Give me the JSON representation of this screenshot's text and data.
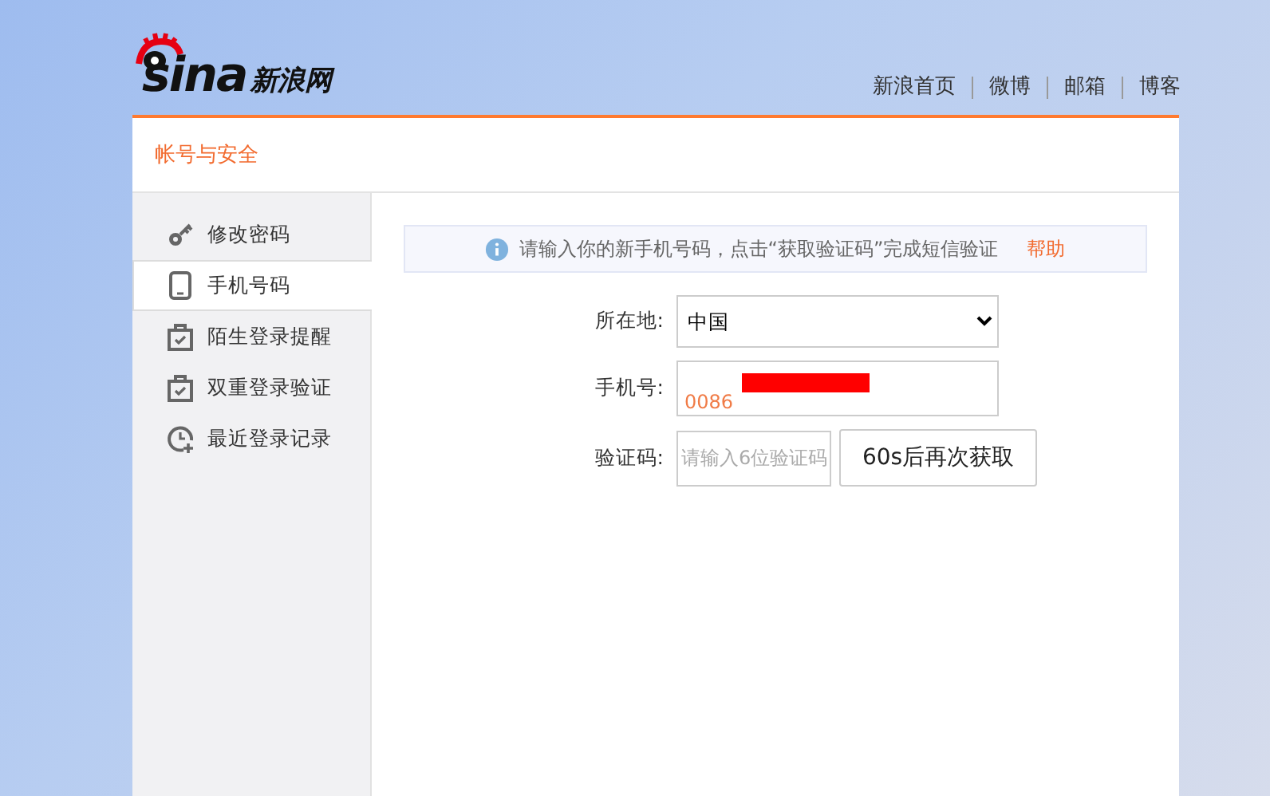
{
  "header": {
    "logo": {
      "latin": "sina",
      "chinese": "新浪网"
    },
    "nav": [
      "新浪首页",
      "微博",
      "邮箱",
      "博客"
    ]
  },
  "panel": {
    "title": "帐号与安全"
  },
  "sidebar": {
    "items": [
      {
        "label": "修改密码",
        "kind": "key",
        "selected": false
      },
      {
        "label": "手机号码",
        "kind": "phone",
        "selected": true
      },
      {
        "label": "陌生登录提醒",
        "kind": "check",
        "selected": false
      },
      {
        "label": "双重登录验证",
        "kind": "check",
        "selected": false
      },
      {
        "label": "最近登录记录",
        "kind": "clock",
        "selected": false
      }
    ]
  },
  "notice": {
    "text": "请输入你的新手机号码，点击“获取验证码”完成短信验证",
    "link": "帮助"
  },
  "form": {
    "region": {
      "label": "所在地:",
      "value": "中国"
    },
    "phone": {
      "label": "手机号:",
      "prefix": "0086",
      "redacted": true
    },
    "code": {
      "label": "验证码:",
      "placeholder": "请输入6位验证码",
      "button": "60s后再次获取"
    }
  }
}
